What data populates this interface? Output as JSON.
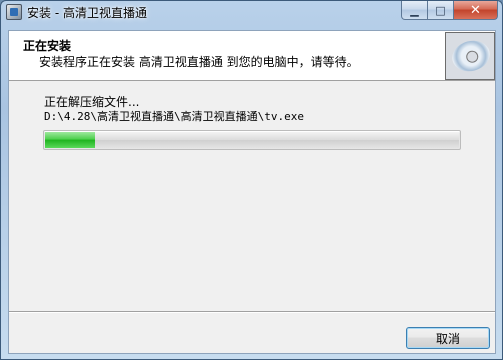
{
  "window": {
    "title": "安装 - 高清卫视直播通",
    "app_icon": "installer-icon",
    "minimize_icon": "minimize-icon",
    "maximize_icon": "maximize-icon",
    "close_icon": "close-icon",
    "minimize_glyph": "▁",
    "maximize_glyph": "□",
    "close_glyph": "✕"
  },
  "header": {
    "title": "正在安装",
    "subtitle": "安装程序正在安装 高清卫视直播通 到您的电脑中，请等待。",
    "logo_icon": "cd-disc-icon"
  },
  "progress": {
    "status_text": "正在解压缩文件...",
    "file_path": "D:\\4.28\\高清卫视直播通\\高清卫视直播通\\tv.exe",
    "fraction": 0.12,
    "color": "#2db82d"
  },
  "footer": {
    "cancel_label": "取消"
  }
}
